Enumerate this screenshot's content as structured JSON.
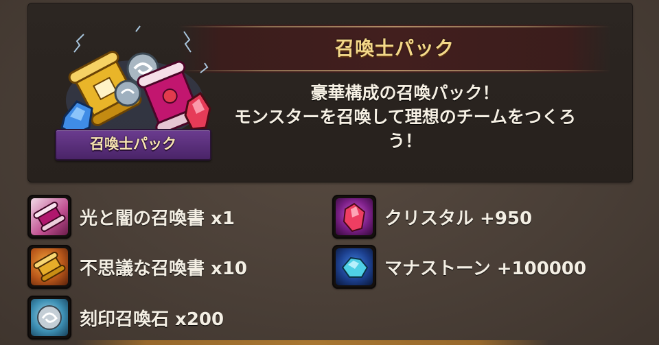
{
  "pack": {
    "title": "召喚士パック",
    "badge_label": "召喚士パック",
    "description_lines": [
      "豪華構成の召喚パック！",
      "モンスターを召喚して理想のチームをつくろ",
      "う！"
    ]
  },
  "contents": [
    {
      "icon": "light-dark-scroll-icon",
      "label": "光と闇の召喚書 x1"
    },
    {
      "icon": "crystal-icon",
      "label": "クリスタル +950"
    },
    {
      "icon": "mystical-scroll-icon",
      "label": "不思議な召喚書 x10"
    },
    {
      "icon": "mana-stone-icon",
      "label": "マナストーン +100000"
    },
    {
      "icon": "summoning-stone-icon",
      "label": "刻印召喚石 x200"
    }
  ],
  "colors": {
    "title_gold": "#f3d889",
    "badge_purple": "#6b3c8f",
    "background": "#4a3f37"
  }
}
